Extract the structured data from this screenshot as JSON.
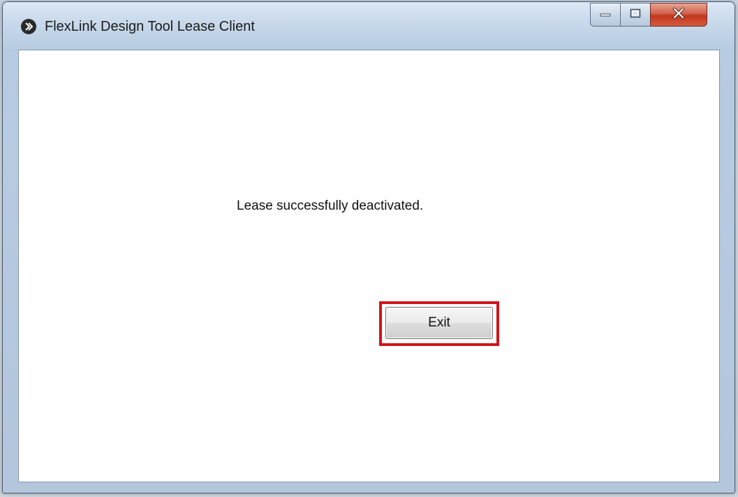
{
  "window": {
    "title": "FlexLink Design Tool Lease Client",
    "app_icon": "flexlink-chevron-icon",
    "controls": {
      "minimize_icon": "minimize-icon",
      "maximize_icon": "maximize-icon",
      "close_icon": "close-icon",
      "close_color": "#c2361f"
    }
  },
  "content": {
    "message": "Lease successfully deactivated.",
    "exit_label": "Exit",
    "highlight_color": "#d0141c"
  }
}
